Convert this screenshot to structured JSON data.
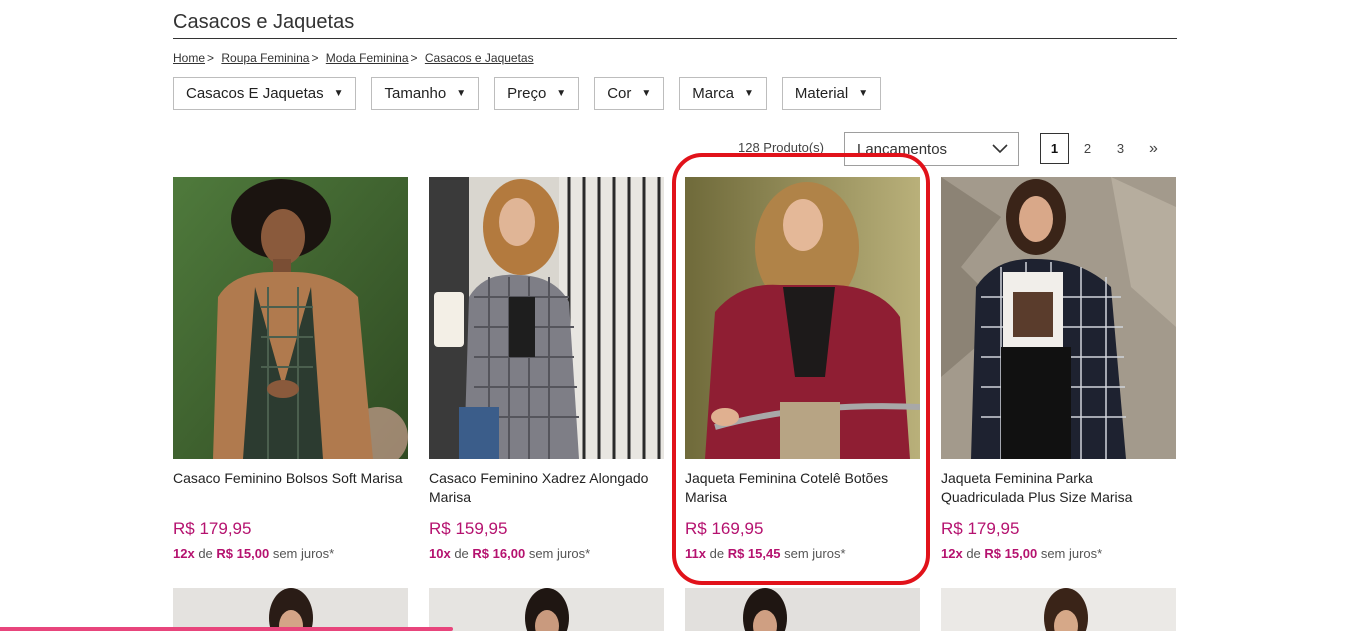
{
  "title": "Casacos e Jaquetas",
  "breadcrumb": {
    "items": [
      "Home",
      "Roupa Feminina",
      "Moda Feminina",
      "Casacos e Jaquetas"
    ],
    "separator": ">"
  },
  "filters": [
    {
      "label": "Casacos E Jaquetas"
    },
    {
      "label": "Tamanho"
    },
    {
      "label": "Preço"
    },
    {
      "label": "Cor"
    },
    {
      "label": "Marca"
    },
    {
      "label": "Material"
    }
  ],
  "results": {
    "count": "128 Produto(s)",
    "sort_value": "Lançamentos"
  },
  "pagination": {
    "pages": [
      "1",
      "2",
      "3"
    ],
    "current": "1",
    "next": "»"
  },
  "products": [
    {
      "name": "Casaco Feminino Bolsos Soft Marisa",
      "price": "R$ 179,95",
      "installments": "12x",
      "de": "de",
      "installment_value": "R$ 15,00",
      "suffix": "sem juros*"
    },
    {
      "name": "Casaco Feminino Xadrez Alongado Marisa",
      "price": "R$ 159,95",
      "installments": "10x",
      "de": "de",
      "installment_value": "R$ 16,00",
      "suffix": "sem juros*"
    },
    {
      "name": "Jaqueta Feminina Cotelê Botões Marisa",
      "price": "R$ 169,95",
      "installments": "11x",
      "de": "de",
      "installment_value": "R$ 15,45",
      "suffix": "sem juros*"
    },
    {
      "name": "Jaqueta Feminina Parka Quadriculada Plus Size Marisa",
      "price": "R$ 179,95",
      "installments": "12x",
      "de": "de",
      "installment_value": "R$ 15,00",
      "suffix": "sem juros*"
    }
  ],
  "colors": {
    "price": "#b5126f",
    "highlight": "#e1121a",
    "progress_bar": "#e8457c"
  }
}
